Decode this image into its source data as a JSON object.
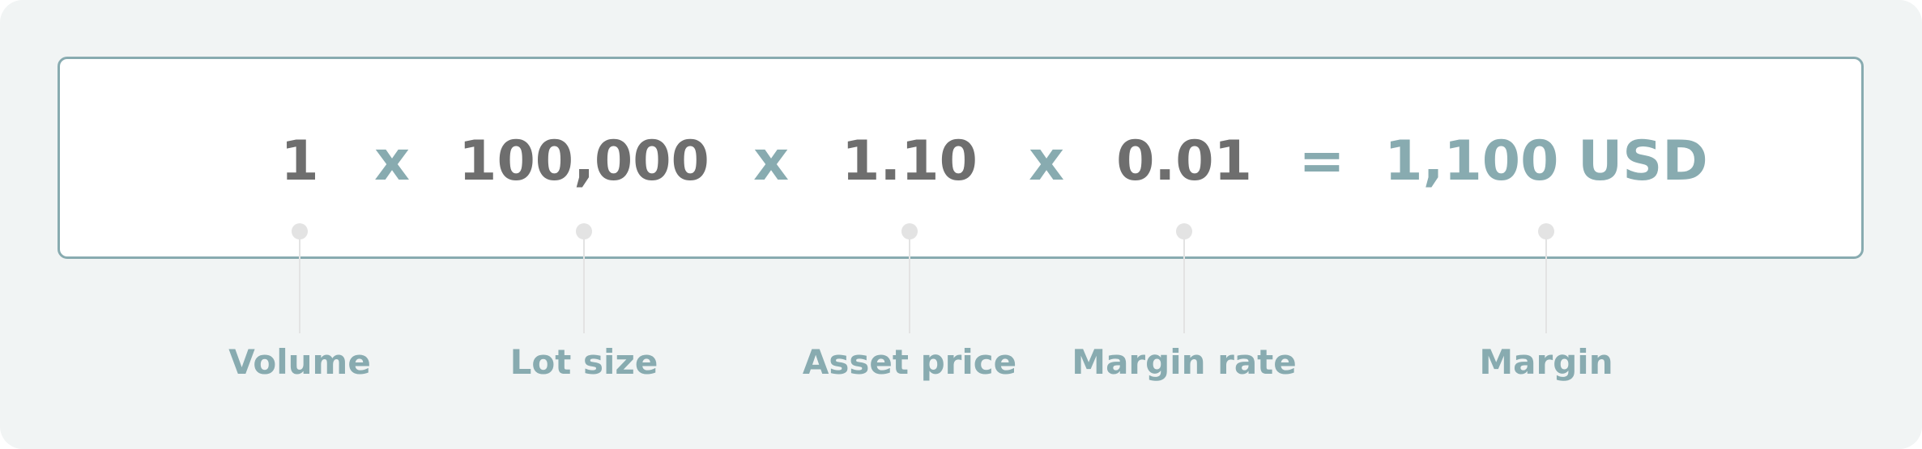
{
  "formula": {
    "terms": [
      {
        "id": "volume",
        "value": "1",
        "label": "Volume"
      },
      {
        "id": "lot-size",
        "value": "100,000",
        "label": "Lot size"
      },
      {
        "id": "asset-price",
        "value": "1.10",
        "label": "Asset price"
      },
      {
        "id": "margin-rate",
        "value": "0.01",
        "label": "Margin rate"
      },
      {
        "id": "margin",
        "value": "1,100 USD",
        "label": "Margin"
      }
    ],
    "operators": [
      "x",
      "x",
      "x",
      "="
    ]
  },
  "colors": {
    "background": "#f1f4f4",
    "box_border": "#88abb0",
    "value_text": "#6e6e6e",
    "accent": "#88abb0",
    "connector": "#e3e3e3"
  }
}
